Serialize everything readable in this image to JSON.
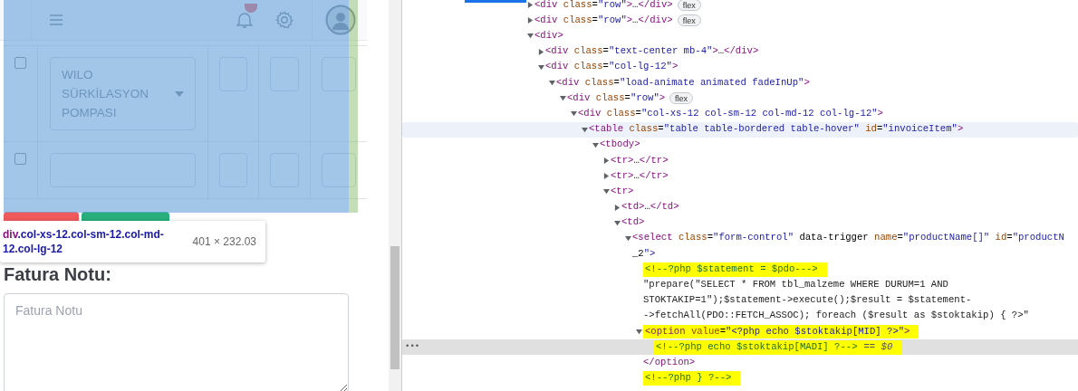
{
  "page": {
    "invoice_rows": [
      {
        "checked": false,
        "product": "WILO SÜRKİLASYON POMPASI"
      },
      {
        "checked": false
      }
    ],
    "note": {
      "heading": "Fatura Notu:",
      "placeholder": "Fatura Notu"
    }
  },
  "inspect_tooltip": {
    "tag": "div",
    "classes": ".col-xs-12.col-sm-12.col-md-12.col-lg-12",
    "size": "401 × 232.03"
  },
  "elements_tree": [
    {
      "kind": "element",
      "lines": [
        "<div class=\"row\">…</div>"
      ],
      "badge": "flex",
      "expanded": false,
      "selected": false,
      "hovered": false,
      "highlighted": false
    },
    {
      "kind": "element",
      "lines": [
        "<div class=\"row\">…</div>"
      ],
      "badge": "flex",
      "expanded": false,
      "selected": false,
      "hovered": false,
      "highlighted": false
    },
    {
      "kind": "element",
      "lines": [
        "<div>"
      ],
      "expanded": true,
      "selected": false,
      "hovered": false,
      "highlighted": false,
      "children": [
        {
          "kind": "element",
          "lines": [
            "<div class=\"text-center mb-4\">…</div>"
          ],
          "expanded": false,
          "selected": false,
          "hovered": false,
          "highlighted": false
        },
        {
          "kind": "element",
          "lines": [
            "<div class=\"col-lg-12\">"
          ],
          "expanded": true,
          "selected": false,
          "hovered": false,
          "highlighted": false,
          "children": [
            {
              "kind": "element",
              "lines": [
                "<div class=\"load-animate animated fadeInUp\">"
              ],
              "expanded": true,
              "selected": false,
              "hovered": false,
              "highlighted": false,
              "children": [
                {
                  "kind": "element",
                  "lines": [
                    "<div class=\"row\">"
                  ],
                  "badge": "flex",
                  "expanded": true,
                  "selected": false,
                  "hovered": false,
                  "highlighted": false,
                  "children": [
                    {
                      "kind": "element",
                      "lines": [
                        "<div class=\"col-xs-12 col-sm-12 col-md-12 col-lg-12\">"
                      ],
                      "expanded": true,
                      "selected": false,
                      "hovered": false,
                      "highlighted": false,
                      "children": [
                        {
                          "kind": "element",
                          "lines": [
                            "<table class=\"table table-bordered table-hover\" id=\"invoiceItem\">"
                          ],
                          "expanded": true,
                          "selected": false,
                          "hovered": true,
                          "highlighted": false,
                          "children": [
                            {
                              "kind": "element",
                              "lines": [
                                "<tbody>"
                              ],
                              "expanded": true,
                              "selected": false,
                              "hovered": false,
                              "highlighted": false,
                              "children": [
                                {
                                  "kind": "element",
                                  "lines": [
                                    "<tr>…</tr>"
                                  ],
                                  "expanded": false,
                                  "selected": false,
                                  "hovered": false,
                                  "highlighted": false
                                },
                                {
                                  "kind": "element",
                                  "lines": [
                                    "<tr>…</tr>"
                                  ],
                                  "expanded": false,
                                  "selected": false,
                                  "hovered": false,
                                  "highlighted": false
                                },
                                {
                                  "kind": "element",
                                  "lines": [
                                    "<tr>"
                                  ],
                                  "expanded": true,
                                  "selected": false,
                                  "hovered": false,
                                  "highlighted": false,
                                  "children": [
                                    {
                                      "kind": "element",
                                      "lines": [
                                        "<td>…</td>"
                                      ],
                                      "expanded": false,
                                      "selected": false,
                                      "hovered": false,
                                      "highlighted": false
                                    },
                                    {
                                      "kind": "element",
                                      "lines": [
                                        "<td>"
                                      ],
                                      "expanded": true,
                                      "selected": false,
                                      "hovered": false,
                                      "highlighted": false,
                                      "children": [
                                        {
                                          "kind": "element",
                                          "lines": [
                                            "<select class=\"form-control\" data-trigger name=\"productName[]\" id=\"productN",
                                            "_2\">"
                                          ],
                                          "expanded": true,
                                          "selected": false,
                                          "hovered": false,
                                          "highlighted": false,
                                          "children": [
                                            {
                                              "kind": "comment",
                                              "lines": [
                                                "<!--?php $statement = $pdo--->"
                                              ],
                                              "selected": false,
                                              "hovered": false,
                                              "highlighted": true
                                            },
                                            {
                                              "kind": "text",
                                              "lines": [
                                                "\"prepare(\"SELECT * FROM tbl_malzeme WHERE DURUM=1 AND",
                                                "STOKTAKIP=1\");$statement->execute();$result = $statement-",
                                                "->fetchAll(PDO::FETCH_ASSOC); foreach ($result as $stoktakip) { ?>\""
                                              ],
                                              "selected": false,
                                              "hovered": false,
                                              "highlighted": false
                                            },
                                            {
                                              "kind": "element",
                                              "lines": [
                                                "<option value=\"<?php echo $stoktakip[MID] ?>\">"
                                              ],
                                              "closing": "</option>",
                                              "expanded": true,
                                              "selected": false,
                                              "hovered": false,
                                              "highlighted": true,
                                              "children": [
                                                {
                                                  "kind": "comment",
                                                  "lines": [
                                                    "<!--?php echo $stoktakip[MADI] ?-->"
                                                  ],
                                                  "console_ref": "== $0",
                                                  "row_menu": "•••",
                                                  "selected": true,
                                                  "hovered": false,
                                                  "highlighted": true
                                                }
                                              ]
                                            },
                                            {
                                              "kind": "comment",
                                              "lines": [
                                                "<!--?php } ?-->"
                                              ],
                                              "selected": false,
                                              "hovered": false,
                                              "highlighted": true
                                            }
                                          ]
                                        }
                                      ]
                                    }
                                  ]
                                }
                              ]
                            }
                          ]
                        }
                      ]
                    }
                  ]
                }
              ]
            }
          ]
        }
      ]
    }
  ]
}
